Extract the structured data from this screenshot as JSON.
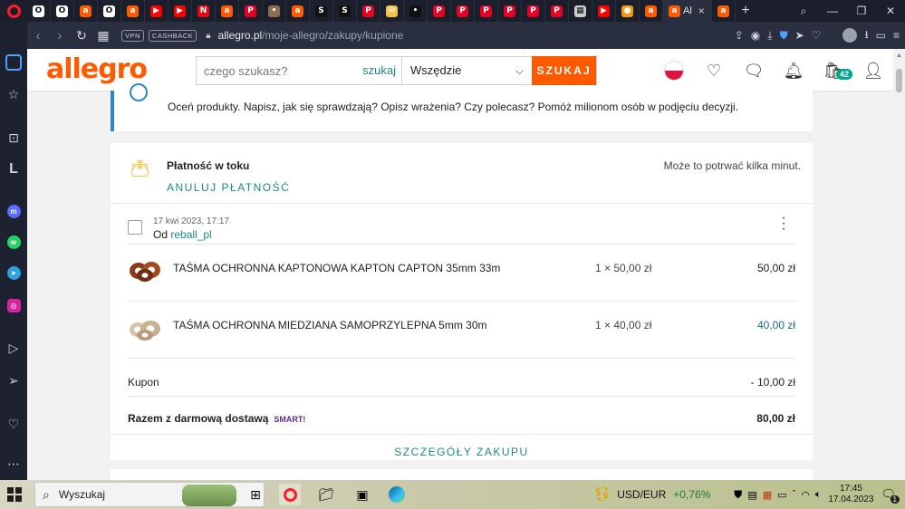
{
  "browser": {
    "active_tab_label": "Al",
    "tab_close": "×",
    "new_tab": "+",
    "tabs": [
      {
        "icon": "opera-tab-icon",
        "color": "#ffffff",
        "glyph": "O"
      },
      {
        "icon": "opera-tab-icon",
        "color": "#ffffff",
        "glyph": "O"
      },
      {
        "icon": "allegro-tab-icon",
        "color": "#ff5a00",
        "glyph": "a"
      },
      {
        "icon": "opera-tab-icon",
        "color": "#ffffff",
        "glyph": "O"
      },
      {
        "icon": "allegro-tab-icon",
        "color": "#ff5a00",
        "glyph": "a"
      },
      {
        "icon": "youtube-tab-icon",
        "color": "#ff0000",
        "glyph": "▶"
      },
      {
        "icon": "youtube-tab-icon",
        "color": "#ff0000",
        "glyph": "▶"
      },
      {
        "icon": "netflix-tab-icon",
        "color": "#e50914",
        "glyph": "N"
      },
      {
        "icon": "allegro-tab-icon",
        "color": "#ff5a00",
        "glyph": "a"
      },
      {
        "icon": "pinterest-tab-icon",
        "color": "#e60023",
        "glyph": "P"
      },
      {
        "icon": "avatar-tab-icon",
        "color": "#8a6d52",
        "glyph": "•"
      },
      {
        "icon": "allegro-tab-icon",
        "color": "#ff5a00",
        "glyph": "a"
      },
      {
        "icon": "s-tab-icon",
        "color": "#111111",
        "glyph": "S"
      },
      {
        "icon": "s-tab-icon",
        "color": "#111111",
        "glyph": "S"
      },
      {
        "icon": "pinterest-tab-icon",
        "color": "#e60023",
        "glyph": "P"
      },
      {
        "icon": "mail-tab-icon",
        "color": "#f2c14e",
        "glyph": "✉"
      },
      {
        "icon": "dark-tab-icon",
        "color": "#111111",
        "glyph": "•"
      },
      {
        "icon": "pinterest-tab-icon",
        "color": "#e60023",
        "glyph": "P"
      },
      {
        "icon": "pinterest-tab-icon",
        "color": "#e60023",
        "glyph": "P"
      },
      {
        "icon": "pinterest-tab-icon",
        "color": "#e60023",
        "glyph": "P"
      },
      {
        "icon": "pinterest-tab-icon",
        "color": "#e60023",
        "glyph": "P"
      },
      {
        "icon": "pinterest-tab-icon",
        "color": "#e60023",
        "glyph": "P"
      },
      {
        "icon": "pinterest-tab-icon",
        "color": "#e60023",
        "glyph": "P"
      },
      {
        "icon": "grid-tab-icon",
        "color": "#cccccc",
        "glyph": "▦"
      },
      {
        "icon": "youtube-tab-icon",
        "color": "#ff0000",
        "glyph": "▶"
      },
      {
        "icon": "coin-tab-icon",
        "color": "#f39c12",
        "glyph": "●"
      },
      {
        "icon": "allegro-tab-icon",
        "color": "#ff5a00",
        "glyph": "a"
      }
    ],
    "last_tab_glyph": "a",
    "vpn_label": "VPN",
    "cashback_label": "CASHBACK",
    "url_host": "allegro.pl",
    "url_path": "/moje-allegro/zakupy/kupione"
  },
  "header": {
    "logo": "allegro",
    "search_placeholder": "czego szukasz?",
    "search_many": "szukaj wielu",
    "scope": "Wszędzie",
    "search_button": "SZUKAJ",
    "cart_count": "42"
  },
  "review_banner": {
    "text": "Oceń produkty. Napisz, jak się sprawdzają? Opisz wrażenia? Czy polecasz? Pomóż milionom osób w podjęciu decyzji."
  },
  "order": {
    "status_title": "Płatność w toku",
    "status_note": "Może to potrwać kilka minut.",
    "cancel_label": "ANULUJ PŁATNOŚĆ",
    "date": "17 kwi 2023, 17:17",
    "seller_prefix": "Od",
    "seller_name": "reball_pl",
    "items": [
      {
        "name": "TAŚMA OCHRONNA KAPTONOWA KAPTON CAPTON 35mm 33m",
        "qty": "1 × 50,00 zł",
        "price": "50,00 zł"
      },
      {
        "name": "TAŚMA OCHRONNA MIEDZIANA SAMOPRZYLEPNA 5mm 30m",
        "qty": "1 × 40,00 zł",
        "price": "40,00 zł"
      }
    ],
    "coupon_label": "Kupon",
    "coupon_value": "- 10,00 zł",
    "total_label": "Razem z darmową dostawą",
    "smart_label": "SMART!",
    "total_value": "80,00 zł",
    "details_label": "SZCZEGÓŁY ZAKUPU"
  },
  "taskbar": {
    "search_placeholder": "Wyszukaj",
    "currency": "USD/EUR",
    "change": "+0,76%",
    "time": "17:45",
    "date": "17.04.2023",
    "notifications": "1"
  },
  "colors": {
    "brand": "#ff5a00",
    "link": "#1a8a7e",
    "info_border": "#2e86c1"
  }
}
